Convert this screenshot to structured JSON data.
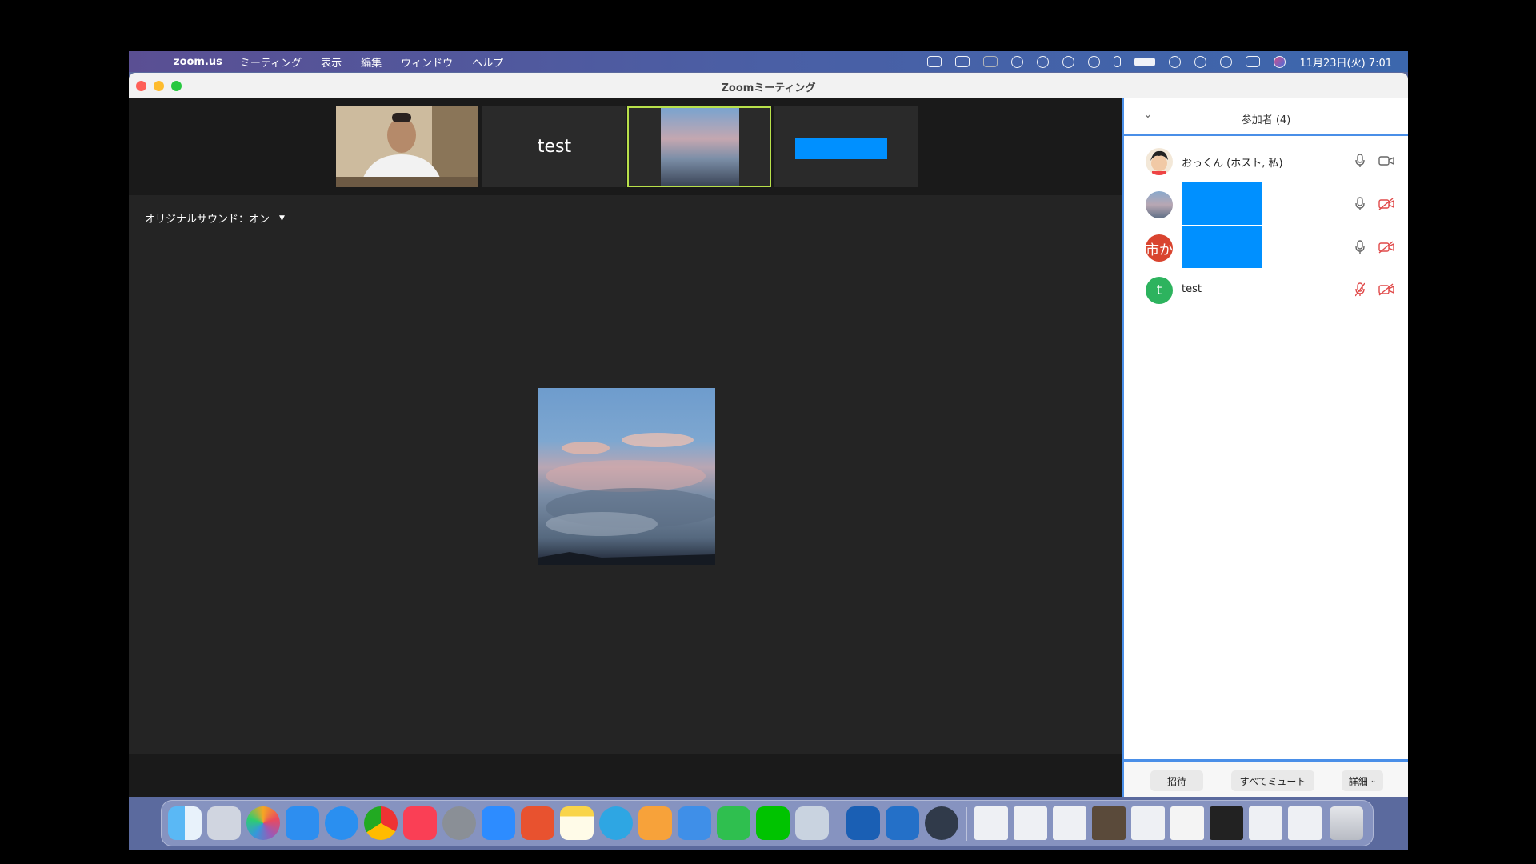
{
  "menubar": {
    "app_name": "zoom.us",
    "menus": [
      "ミーティング",
      "表示",
      "編集",
      "ウィンドウ",
      "ヘルプ"
    ],
    "clock": "11月23日(火)  7:01"
  },
  "window": {
    "title": "Zoomミーティング"
  },
  "thumbnails": [
    {
      "kind": "camera",
      "label": ""
    },
    {
      "kind": "name",
      "label": "test"
    },
    {
      "kind": "sky",
      "label": ""
    },
    {
      "kind": "redacted",
      "label": ""
    }
  ],
  "original_sound": {
    "label": "オリジナルサウンド：オン"
  },
  "participants": {
    "title": "参加者 (4)",
    "rows": [
      {
        "name": "おっくん (ホスト, 私)",
        "avatar": "avatar-photo",
        "muted": false,
        "video_off": false
      },
      {
        "name": "",
        "avatar": "sky-photo",
        "muted": false,
        "video_off": true
      },
      {
        "name": "",
        "avatar_text": "市か",
        "muted": false,
        "video_off": true
      },
      {
        "name": "test",
        "avatar_text": "t",
        "muted": true,
        "video_off": true
      }
    ],
    "footer": {
      "invite": "招待",
      "mute_all": "すべてミュート",
      "more": "詳細"
    }
  },
  "colors": {
    "accent": "#4a8fe8",
    "redact": "#0090ff",
    "muted_red": "#e04a4a",
    "avatar_red": "#d9442f",
    "avatar_green": "#2db35e"
  },
  "dock": {
    "icons": [
      "finder-icon",
      "launchpad-icon",
      "photos-icon",
      "mail-icon",
      "safari-icon",
      "chrome-icon",
      "music-icon",
      "system-preferences-icon",
      "zoom-icon",
      "x-app-icon",
      "notes-icon",
      "telegram-icon",
      "pages-icon",
      "keynote-icon",
      "numbers-icon",
      "line-icon",
      "preview-icon",
      "scansnap-icon",
      "scansnap-2-icon",
      "quicktime-icon"
    ]
  }
}
